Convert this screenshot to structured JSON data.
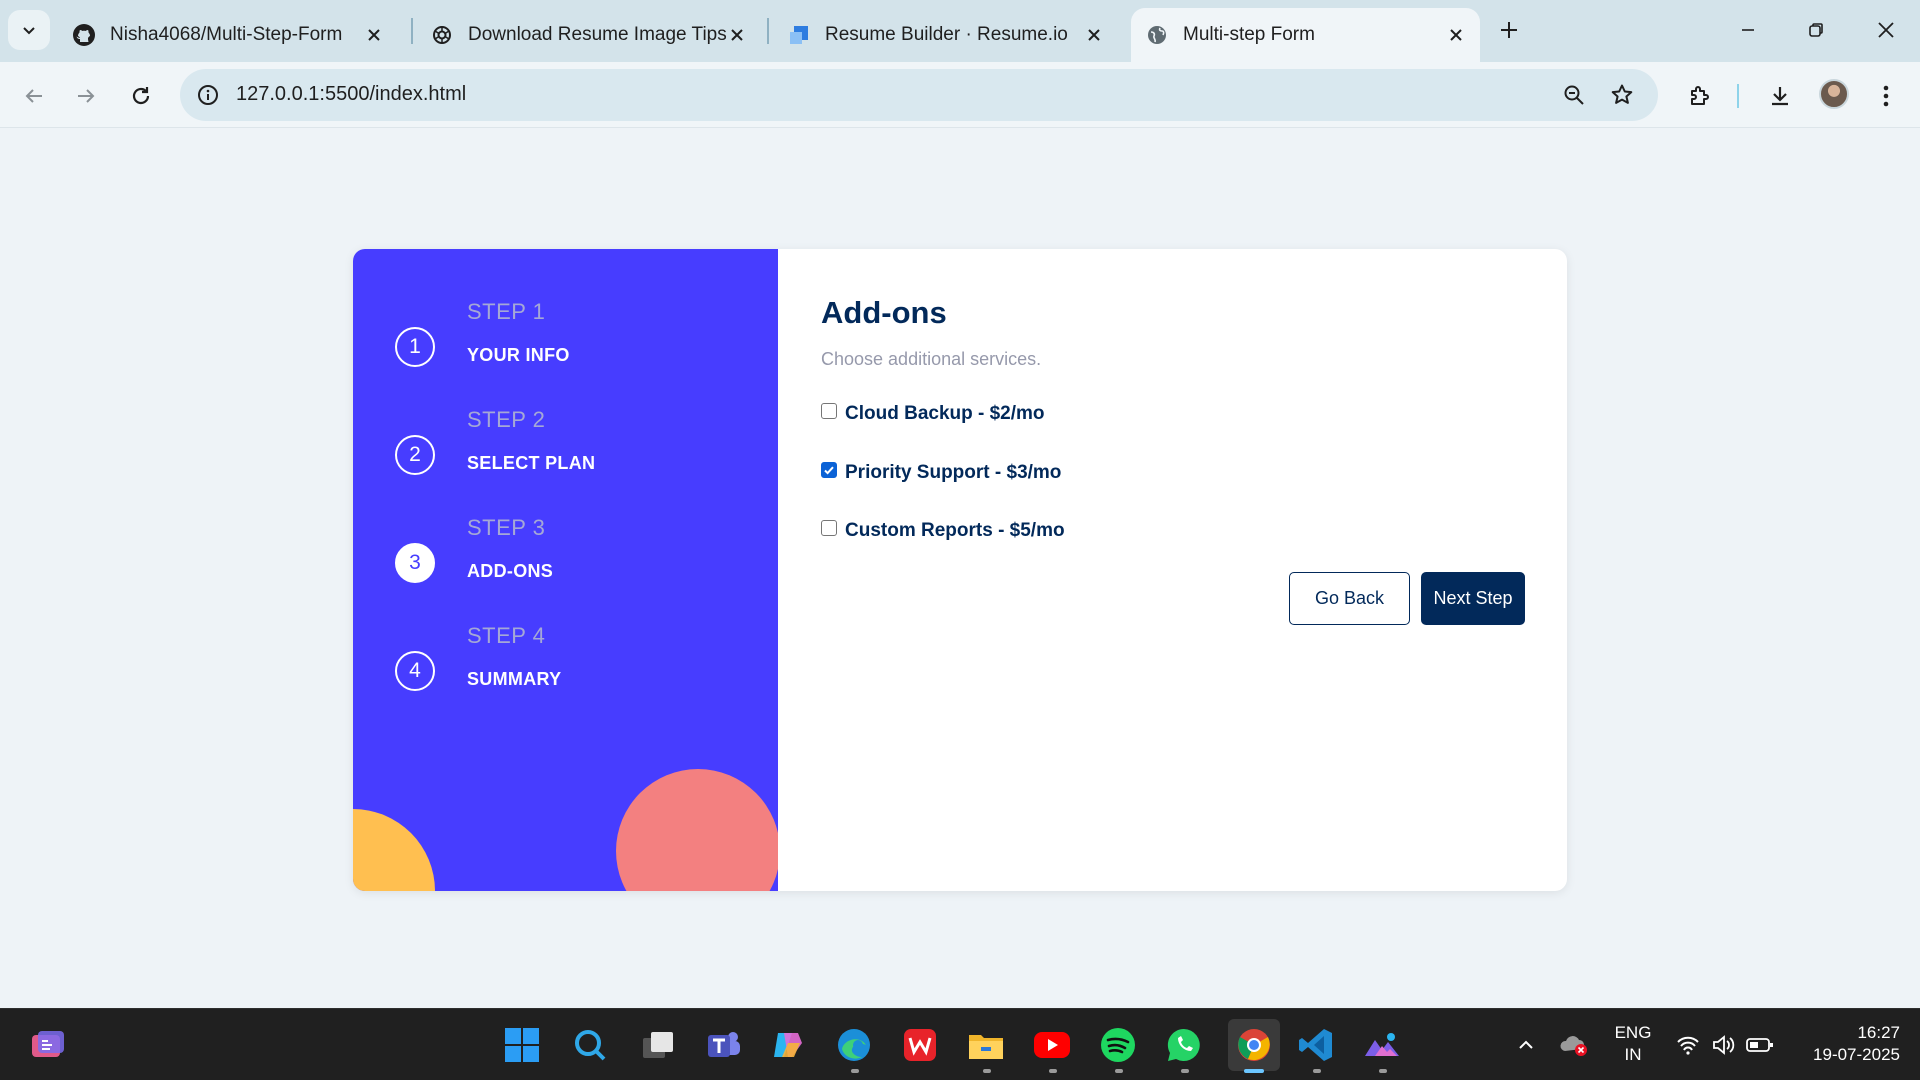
{
  "browser": {
    "tabs": [
      {
        "title": "Nisha4068/Multi-Step-Form",
        "icon": "github-icon",
        "active": false
      },
      {
        "title": "Download Resume Image Tips",
        "icon": "openai-icon",
        "active": false
      },
      {
        "title": "Resume Builder · Resume.io",
        "icon": "resumeio-icon",
        "active": false
      },
      {
        "title": "Multi-step Form",
        "icon": "globe-icon",
        "active": true
      }
    ],
    "url": "127.0.0.1:5500/index.html"
  },
  "sidebar": {
    "steps": [
      {
        "number": "1",
        "label": "STEP 1",
        "title": "YOUR INFO",
        "active": false
      },
      {
        "number": "2",
        "label": "STEP 2",
        "title": "SELECT PLAN",
        "active": false
      },
      {
        "number": "3",
        "label": "STEP 3",
        "title": "ADD-ONS",
        "active": true
      },
      {
        "number": "4",
        "label": "STEP 4",
        "title": "SUMMARY",
        "active": false
      }
    ],
    "colors": {
      "background": "#473dff",
      "circle_left": "#ffbf50",
      "circle_right": "#f38080"
    }
  },
  "form": {
    "title": "Add-ons",
    "subtitle": "Choose additional services.",
    "addons": [
      {
        "label": "Cloud Backup - $2/mo",
        "checked": false
      },
      {
        "label": "Priority Support - $3/mo",
        "checked": true
      },
      {
        "label": "Custom Reports - $5/mo",
        "checked": false
      }
    ],
    "back_label": "Go Back",
    "next_label": "Next Step",
    "colors": {
      "primary": "#02295a",
      "muted": "#9699ab"
    }
  },
  "taskbar": {
    "apps": [
      "start-icon",
      "search-icon",
      "task-view-icon",
      "teams-icon",
      "copilot-icon",
      "edge-icon",
      "wps-icon",
      "file-explorer-icon",
      "youtube-icon",
      "spotify-icon",
      "whatsapp-icon",
      "chrome-icon",
      "vscode-icon",
      "photos-icon"
    ],
    "language": "ENG",
    "region": "IN",
    "time": "16:27",
    "date": "19-07-2025"
  }
}
